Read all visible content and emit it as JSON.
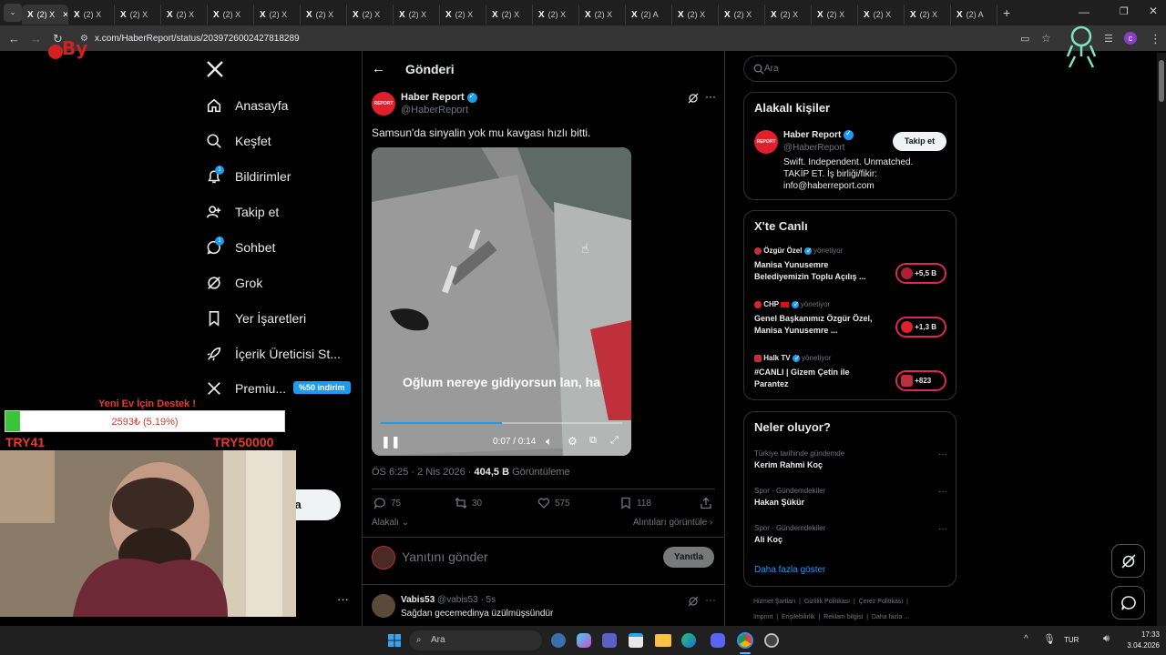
{
  "browser": {
    "tabs": [
      "(2) X",
      "(2) X",
      "(2) X",
      "(2) X",
      "(2) X",
      "(2) X",
      "(2) X",
      "(2) X",
      "(2) X",
      "(2) X",
      "(2) X",
      "(2) X",
      "(2) X",
      "(2) A",
      "(2) X",
      "(2) X",
      "(2) X",
      "(2) X",
      "(2) X",
      "(2) X",
      "(2) A"
    ],
    "url": "x.com/HaberReport/status/2039726002427818289",
    "profile_letter": "c"
  },
  "overlay": {
    "donation_title": "Yeni Ev İçin Destek !",
    "donation_amount": "2593₺ (5.19%)",
    "donation_progress": 0.0519,
    "donation_min": "TRY41",
    "donation_max": "TRY50000",
    "partial_button": "nla"
  },
  "sidebar": {
    "logo": "X",
    "items": [
      {
        "label": "Anasayfa",
        "icon": "home-icon"
      },
      {
        "label": "Keşfet",
        "icon": "search-icon"
      },
      {
        "label": "Bildirimler",
        "icon": "bell-icon",
        "badge": "1"
      },
      {
        "label": "Takip et",
        "icon": "person-add-icon"
      },
      {
        "label": "Sohbet",
        "icon": "chat-icon",
        "badge": "1"
      },
      {
        "label": "Grok",
        "icon": "grok-icon"
      },
      {
        "label": "Yer İşaretleri",
        "icon": "bookmark-icon"
      },
      {
        "label": "İçerik Üreticisi St...",
        "icon": "rocket-icon"
      },
      {
        "label": "Premiu...",
        "icon": "x-icon",
        "tag": "%50 indirim"
      }
    ],
    "more": "···"
  },
  "post": {
    "header_title": "Gönderi",
    "author_name": "Haber Report",
    "author_handle": "@HaberReport",
    "avatar_text": "REPORT",
    "text": "Samsun'da sinyalin yok mu kavgası hızlı bitti.",
    "video_caption": "Oğlum nereye gidiyorsun lan, ha",
    "video_time": "0:07 / 0:14",
    "video_progress": 0.5,
    "meta_time": "ÖS 6:25 · 2 Nis 2026 · ",
    "views": "404,5 B",
    "views_label": " Görüntüleme",
    "replies": "75",
    "reposts": "30",
    "likes": "575",
    "bookmarks": "118",
    "sort_label": "Alakalı",
    "quotes_link": "Alıntıları görüntüle",
    "reply_placeholder": "Yanıtını gönder",
    "reply_button": "Yanıtla"
  },
  "reply": {
    "name": "Vabis53",
    "handle": "@vabis53 · 5s",
    "text": "Sağdan gecemedinya üzülmüşsündür"
  },
  "right": {
    "search_placeholder": "Ara",
    "relevant_title": "Alakalı kişiler",
    "relevant": {
      "name": "Haber Report",
      "handle": "@HaberReport",
      "bio": "Swift. Independent. Unmatched. TAKİP ET. İş birliği/fikir: info@haberreport.com",
      "follow": "Takip et"
    },
    "live_title": "X'te Canlı",
    "live": [
      {
        "host": "Özgür Özel",
        "status": "yönetiyor",
        "title": "Manisa Yunusemre Belediyemizin Toplu Açılış ...",
        "count": "+5,5 B"
      },
      {
        "host": "CHP",
        "status": "yönetiyor",
        "title": "Genel Başkanımız Özgür Özel, Manisa Yunusemre ...",
        "count": "+1,3 B"
      },
      {
        "host": "Halk TV",
        "status": "yönetiyor",
        "title": "#CANLI | Gizem Çetin ile Parantez",
        "count": "+823"
      }
    ],
    "trends_title": "Neler oluyor?",
    "trends": [
      {
        "context": "Türkiye tarihinde gündemde",
        "name": "Kerim Rahmi Koç"
      },
      {
        "context": "Spor · Gündemdekiler",
        "name": "Hakan Şükür"
      },
      {
        "context": "Spor · Gündemdekiler",
        "name": "Ali Koç"
      }
    ],
    "show_more": "Daha fazla göster",
    "footer_line1": "Hizmet Şartları  |  Gizlilik Politikası  |  Çerez Politikası  |",
    "footer_line2": "Imprint  |  Erişilebilirlik  |  Reklam bilgisi  |  Daha fazla ..."
  },
  "taskbar": {
    "search": "Ara",
    "lang": "TUR",
    "time": "17:33",
    "date": "3.04.2026"
  },
  "colors": {
    "accent": "#1d9bf0",
    "brand_red": "#e0202b",
    "bg": "#000000"
  }
}
